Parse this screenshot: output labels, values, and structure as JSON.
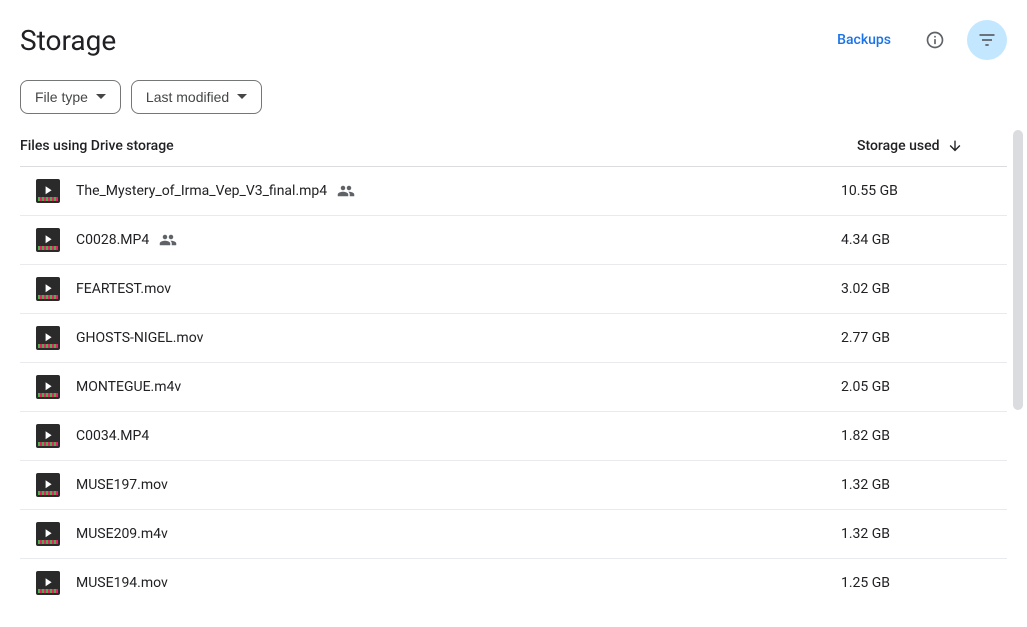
{
  "header": {
    "title": "Storage",
    "backups_label": "Backups"
  },
  "filters": {
    "file_type_label": "File type",
    "last_modified_label": "Last modified"
  },
  "table": {
    "col_name_label": "Files using Drive storage",
    "col_size_label": "Storage used"
  },
  "files": [
    {
      "name": "The_Mystery_of_Irma_Vep_V3_final.mp4",
      "size": "10.55 GB",
      "shared": true
    },
    {
      "name": "C0028.MP4",
      "size": "4.34 GB",
      "shared": true
    },
    {
      "name": "FEARTEST.mov",
      "size": "3.02 GB",
      "shared": false
    },
    {
      "name": "GHOSTS-NIGEL.mov",
      "size": "2.77 GB",
      "shared": false
    },
    {
      "name": "MONTEGUE.m4v",
      "size": "2.05 GB",
      "shared": false
    },
    {
      "name": "C0034.MP4",
      "size": "1.82 GB",
      "shared": false
    },
    {
      "name": "MUSE197.mov",
      "size": "1.32 GB",
      "shared": false
    },
    {
      "name": "MUSE209.m4v",
      "size": "1.32 GB",
      "shared": false
    },
    {
      "name": "MUSE194.mov",
      "size": "1.25 GB",
      "shared": false
    }
  ]
}
